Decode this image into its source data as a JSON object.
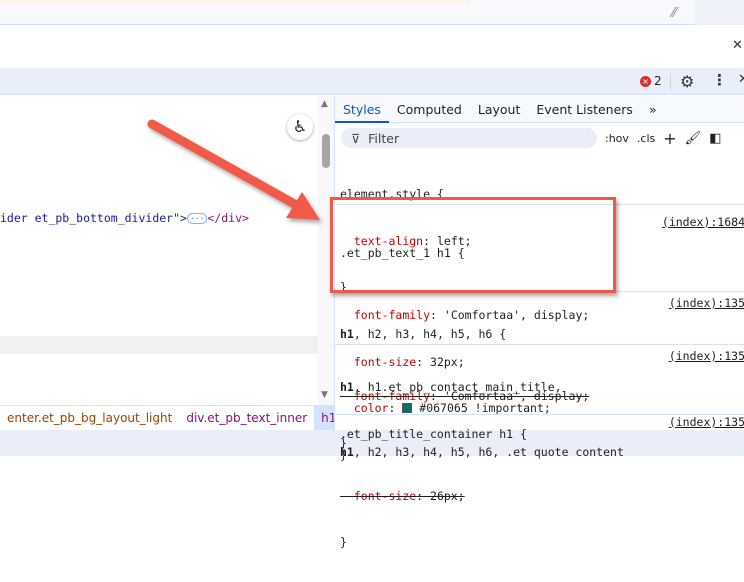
{
  "drawer": {
    "close_icon": "close-icon"
  },
  "toolbar": {
    "error_count": "2",
    "error_icon": "×"
  },
  "elements": {
    "dom_line_text": "ider et_pb_bottom_divider\">",
    "dom_line_ellipsis": "···",
    "dom_line_close": "</div>"
  },
  "breadcrumbs": [
    "enter.et_pb_bg_layout_light",
    "div.et_pb_text_inner",
    "h1"
  ],
  "styles": {
    "tabs": [
      "Styles",
      "Computed",
      "Layout",
      "Event Listeners"
    ],
    "tabs_more": "»",
    "filter_placeholder": "Filter",
    "hov": ":hov",
    "cls": ".cls",
    "rules": [
      {
        "selector": "element.style {",
        "props": [
          {
            "name": "text-align",
            "value": " left;"
          }
        ],
        "close": "}"
      },
      {
        "selector": ".et_pb_text_1 h1 {",
        "source": "(index):1684",
        "props": [
          {
            "name": "font-family",
            "value": " 'Comfortaa', display;"
          },
          {
            "name": "font-size",
            "value": " 32px;"
          },
          {
            "name": "color",
            "value": "#067065 !important;"
          }
        ],
        "close": "}"
      },
      {
        "selector_bold": "h1",
        "selector_rest": ", h2, h3, h4, h5, h6 {",
        "source": "(index):135",
        "props": [
          {
            "name": "font-family",
            "value": " 'Comfortaa', display;"
          }
        ],
        "close": "}"
      },
      {
        "selector_bold": "h1",
        "selector_rest": ", h1.et_pb_contact_main_title,",
        "selector_line2": ".et_pb_title_container h1 {",
        "source": "(index):135",
        "props": [
          {
            "name": "font-size",
            "value": " 26px;"
          }
        ],
        "close": "}"
      },
      {
        "selector_bold": "h1",
        "selector_rest": ", h2, h3, h4, h5, h6, .et quote content",
        "source": "(index):135"
      }
    ]
  },
  "colors": {
    "swatch": "#067065",
    "accent": "#0b57d0",
    "annotation": "#ef5a48"
  }
}
